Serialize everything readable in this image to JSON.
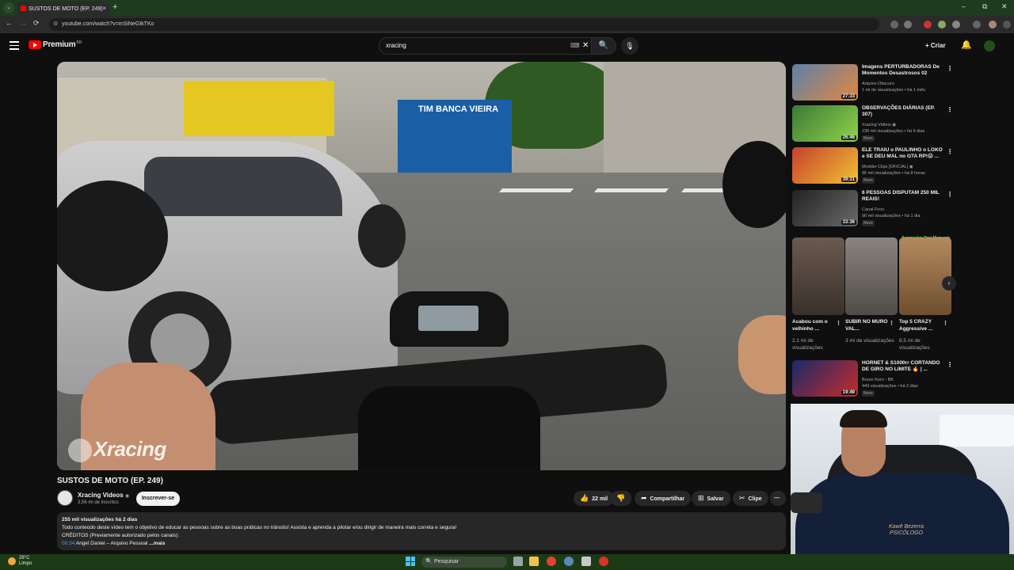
{
  "browser": {
    "tab_title": "SUSTOS DE MOTO (EP. 249)",
    "tab_close": "×",
    "new_tab": "+",
    "url": "youtube.com/watch?v=mSiNeGIkTKo",
    "nav": {
      "back": "←",
      "forward": "→",
      "reload": "⟳"
    },
    "window": {
      "minimize": "–",
      "maximize": "⧉",
      "close": "✕"
    }
  },
  "youtube": {
    "logo_word": "Premium",
    "logo_region": "BR",
    "search_query": "xracing",
    "keyboard_icon": "⌨",
    "clear_icon": "✕",
    "search_icon": "🔍",
    "mic_icon": "🎙",
    "create_label": "Criar",
    "create_icon": "+",
    "bell_icon": "🔔"
  },
  "video": {
    "title": "SUSTOS DE MOTO (EP. 249)",
    "watermark": "Xracing",
    "kiosk_sign": "TIM  BANCA VIEIRA",
    "channel_name": "Xracing Videos",
    "verified": "◉",
    "subscribers": "3,56 mi de inscritos",
    "subscribe_label": "Inscrever-se",
    "likes": "22 mil",
    "like_icon": "👍",
    "dislike_icon": "👎",
    "share_label": "Compartilhar",
    "share_icon": "➦",
    "save_label": "Salvar",
    "save_icon": "⊞",
    "clip_label": "Clipe",
    "clip_icon": "✂",
    "more_icon": "⋯"
  },
  "description": {
    "stats": "255 mil visualizações  há 2 dias",
    "line1": "Todo conteúdo deste vídeo tem o objetivo de educar as pessoas sobre as boas práticas no trânsito! Assista e aprenda a pilotar e/ou dirigir de maneira mais correta e segura!",
    "line2": "CRÉDITOS (Previamente autorizado pelos canais):",
    "timestamp": "00:34",
    "line3": " Angel Daniel – Arquivo Pessoal",
    "more": " ...mais"
  },
  "recommendations": [
    {
      "title": "Imagens PERTURBADORAS De Momentos Desastrosos 02",
      "channel": "Arquivo Obscuro",
      "meta": "1 mi de visualizações • há 1 mês",
      "duration": "27:33",
      "badge": "",
      "thumb_color": "#4a6a8a"
    },
    {
      "title": "OBSERVAÇÕES DIÁRIAS (EP. 307)",
      "channel": "Xracing Videos ◉",
      "meta": "238 mil visualizações • há 6 dias",
      "duration": "26:46",
      "badge": "Novo",
      "thumb_color": "#3b7a36"
    },
    {
      "title": "ELE TRAIU o PAULINHO o LOKO e SE DEU MAL no GTA RP!😱 ...",
      "channel": "Modder Clips [OFICIAL] ◉",
      "meta": "96 mil visualizações • há 8 horas",
      "duration": "39:31",
      "badge": "Novo",
      "thumb_color": "#b33a2a"
    },
    {
      "title": "6 PESSOAS DISPUTAM 250 MIL REAIS!",
      "channel": "Canal Foco",
      "meta": "90 mil visualizações • há 1 dia",
      "duration": "33:36",
      "badge": "Novo",
      "thumb_color": "#2a2a2a"
    },
    {
      "title": "HORNET & S1000rr CORTANDO DE GIRO NO LIMITE 🔥 | ...",
      "channel": "Bruno Kern - BK",
      "meta": "449 visualizações • há 2 dias",
      "duration": "19:49",
      "badge": "Novo",
      "thumb_color": "#7a1f1f"
    }
  ],
  "shorts": {
    "header": "Aggressive Dog Moments",
    "items": [
      {
        "title": "Acabou com o velhinho ...",
        "views": "2,1 mi de visualizações",
        "thumb_color": "#5c4f47"
      },
      {
        "title": "SUBIR NO MURO VAL...",
        "views": "3 mi de visualizações",
        "thumb_color": "#6a6660"
      },
      {
        "title": "Top 5 CRAZY Aggressive ...",
        "views": "8,5 mi de visualizações",
        "thumb_color": "#8a6a4a"
      }
    ],
    "next_icon": "›"
  },
  "webcam": {
    "shirt_text": "Kawê Bezerra\nPSICÓLOGO"
  },
  "taskbar": {
    "temperature": "28°C",
    "weather": "Limpo",
    "search_placeholder": "Pesquisar",
    "search_icon": "🔍"
  },
  "colors": {
    "accent": "#ff0000",
    "link": "#3ea6ff",
    "tabbar": "#1e3a1f",
    "taskbar": "#1c3a15"
  }
}
